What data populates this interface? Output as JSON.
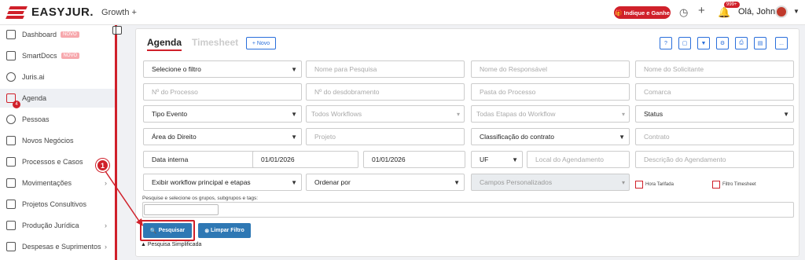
{
  "brand": {
    "name": "EASYJUR.",
    "plan": "Growth +"
  },
  "top": {
    "indique": "Indique e Ganhe",
    "notif_badge": "999+",
    "greeting": "Olá, Johnny"
  },
  "sidebar": {
    "items": [
      {
        "label": "Dashboard",
        "badge": "NOVO"
      },
      {
        "label": "SmartDocs",
        "badge": "NOVO"
      },
      {
        "label": "Juris.ai"
      },
      {
        "label": "Agenda"
      },
      {
        "label": "Pessoas"
      },
      {
        "label": "Novos Negócios"
      },
      {
        "label": "Processos e Casos"
      },
      {
        "label": "Movimentações"
      },
      {
        "label": "Projetos Consultivos"
      },
      {
        "label": "Produção Jurídica"
      },
      {
        "label": "Despesas e Suprimentos"
      }
    ],
    "agenda_badge": "4"
  },
  "tabs": {
    "agenda": "Agenda",
    "timesheet": "Timesheet",
    "novo": "+ Novo"
  },
  "toolbar": [
    "?",
    "▢",
    "▼",
    "⚙",
    "⎙",
    "▤",
    "..."
  ],
  "filters": {
    "r1": [
      "Selecione o filtro",
      "Nome para Pesquisa",
      "Nome do Responsável",
      "Nome do Solicitante"
    ],
    "r2": [
      "Nº do Processo",
      "Nº do desdobramento",
      "Pasta do Processo",
      "Comarca"
    ],
    "r3": [
      "Tipo Evento",
      "Todos Workflows",
      "Todas Etapas do Workflow",
      "Status"
    ],
    "r4": [
      "Área do Direito",
      "Projeto",
      "Classificação do contrato",
      "Contrato"
    ],
    "r5": [
      "Data interna",
      "01/01/2026",
      "01/01/2026",
      "UF",
      "Local do Agendamento",
      "Descrição do Agendamento"
    ],
    "r6": [
      "Exibir workflow principal e etapas",
      "Ordenar por",
      "Campos Personalizados",
      "Hora Tarifada",
      "Filtro Timesheet"
    ]
  },
  "tags_label": "Pesquise e selecione os grupos, subgrupos e tags:",
  "buttons": {
    "pesquisar": "Pesquisar",
    "limpar": "Limpar Filtro"
  },
  "simplificada": "Pesquisa Simplificada",
  "step_number": "1"
}
